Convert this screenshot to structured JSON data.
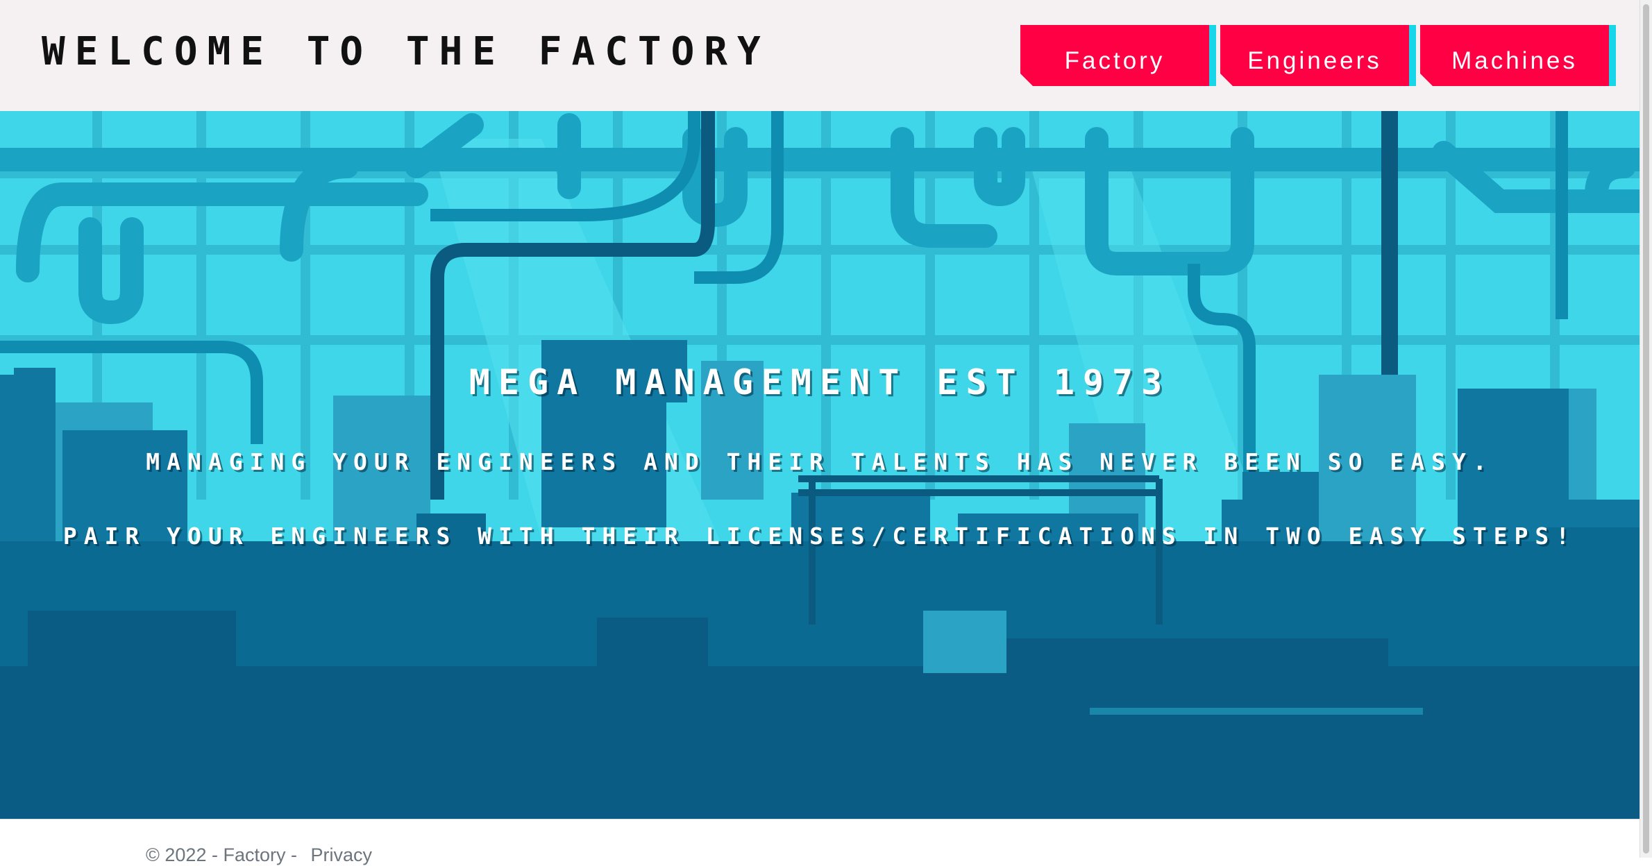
{
  "header": {
    "title": "Welcome to the Factory",
    "nav": [
      {
        "label": "Factory"
      },
      {
        "label": "Engineers"
      },
      {
        "label": "Machines"
      }
    ]
  },
  "hero": {
    "heading": "Mega Management Est 1973",
    "line1": "Managing your engineers and their talents has never been so easy.",
    "line2": "Pair your engineers with their licenses/certifications in two easy steps!"
  },
  "footer": {
    "copyright": "© 2022 - Factory - ",
    "privacy_link": "Privacy"
  },
  "colors": {
    "nav_button": "#ff0044",
    "nav_accent": "#18d6ea",
    "header_bg": "#f5f1f3",
    "hero_sky": "#3ed6e8",
    "hero_dark": "#0b5a80"
  },
  "icons": [
    "factory-background-illustration"
  ]
}
